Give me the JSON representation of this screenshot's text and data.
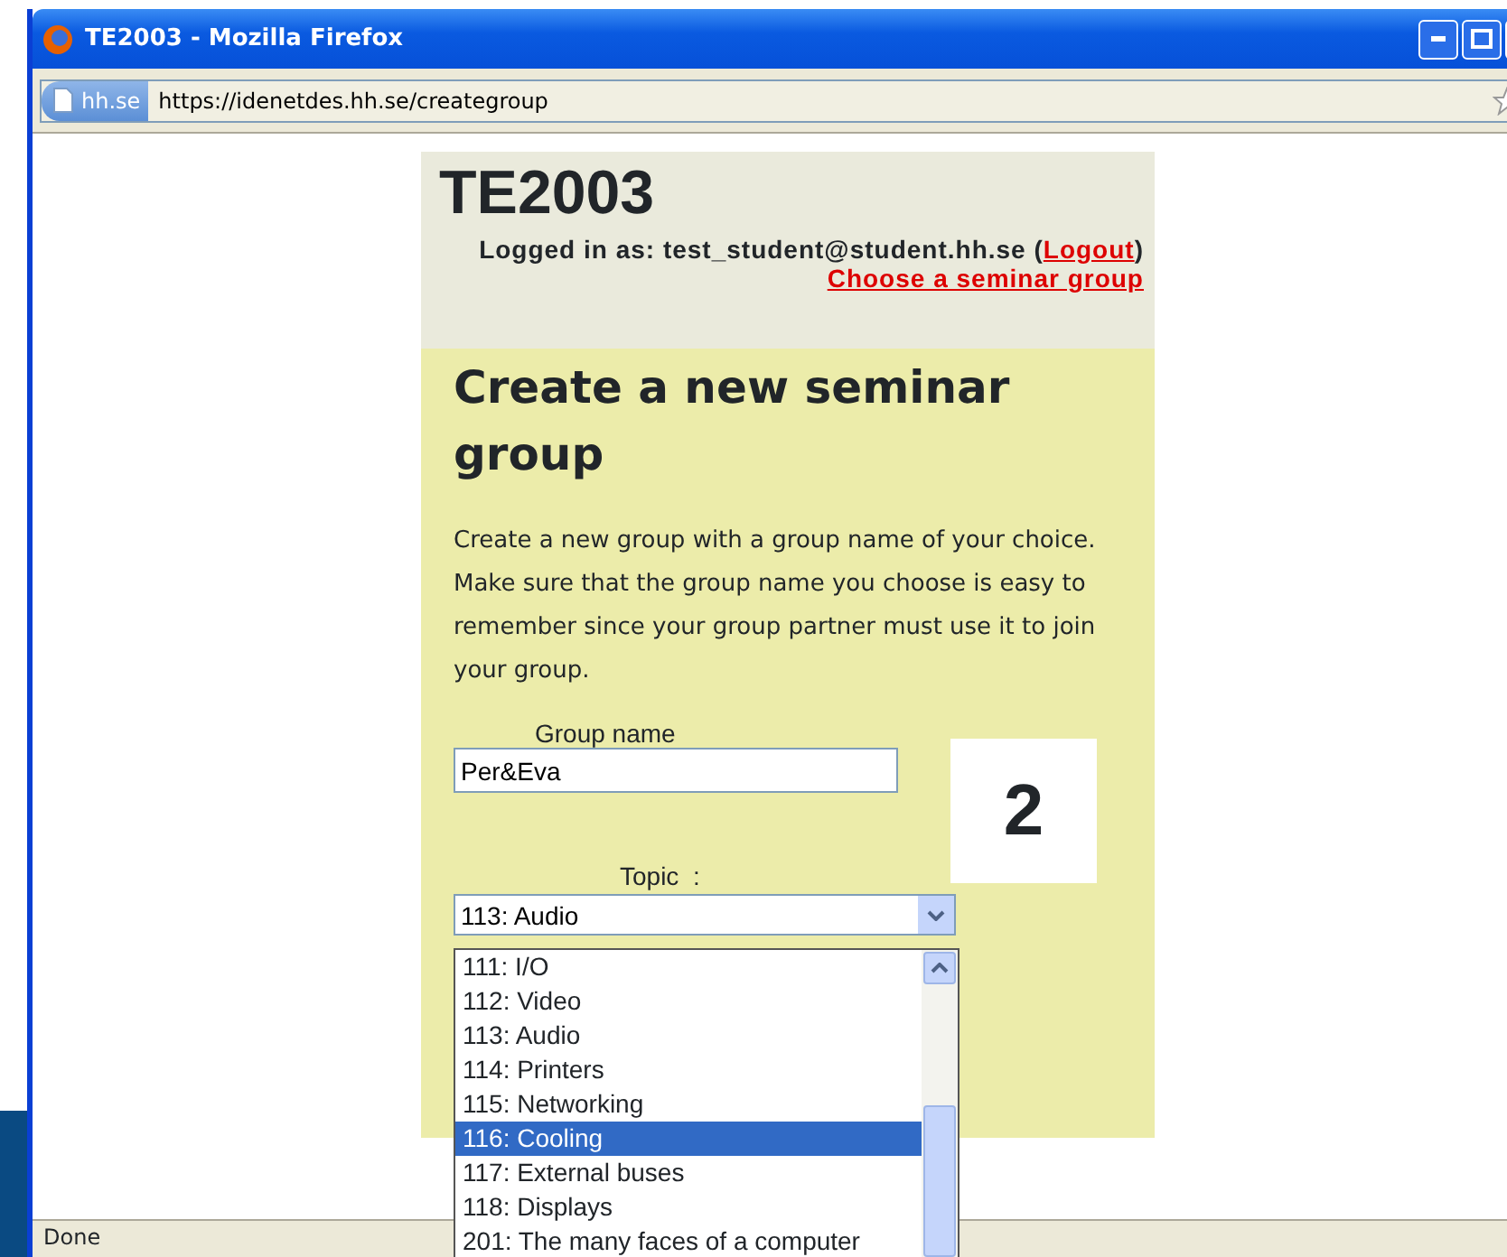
{
  "window": {
    "title": "TE2003 - Mozilla Firefox"
  },
  "address_bar": {
    "site": "hh.se",
    "url": "https://idenetdes.hh.se/creategroup"
  },
  "header": {
    "course": "TE2003",
    "logged_in_label": "Logged in as: test_student@student.hh.se (",
    "logout_link": "Logout",
    "logged_in_close": ")",
    "choose_link": "Choose a seminar group"
  },
  "form": {
    "heading": "Create a new seminar group",
    "description": "Create a new group with a group name of your choice. Make sure that the group name you choose is easy to remember since your group partner must use it to join your group.",
    "group_name_label": "Group name",
    "group_name_value": "Per&Eva",
    "step_number": "2",
    "topic_label": "Topic  :",
    "topic_value": "113: Audio",
    "topic_options": [
      {
        "label": "111: I/O",
        "selected": false
      },
      {
        "label": "112: Video",
        "selected": false
      },
      {
        "label": "113: Audio",
        "selected": false
      },
      {
        "label": "114: Printers",
        "selected": false
      },
      {
        "label": "115: Networking",
        "selected": false
      },
      {
        "label": "116: Cooling",
        "selected": true
      },
      {
        "label": "117: External buses",
        "selected": false
      },
      {
        "label": "118: Displays",
        "selected": false
      },
      {
        "label": "201: The many faces of a computer",
        "selected": false
      }
    ]
  },
  "status_bar": {
    "text": "Done"
  }
}
